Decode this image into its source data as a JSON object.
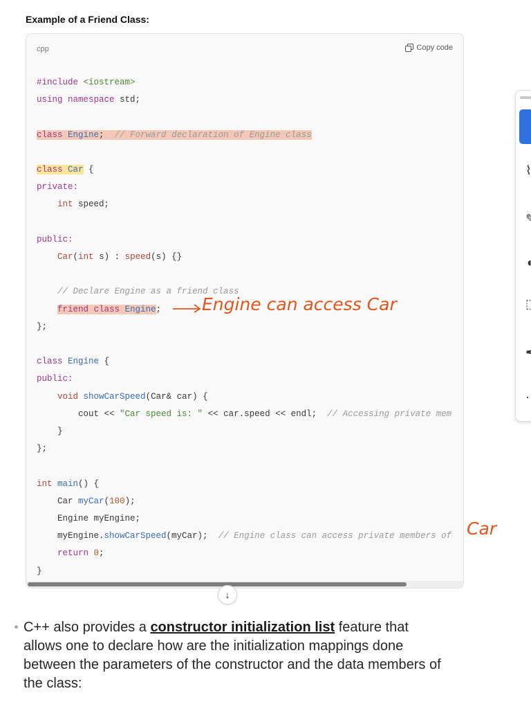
{
  "heading": "Example of a Friend Class:",
  "code_block": {
    "language": "cpp",
    "copy_label": "Copy code",
    "lines": {
      "l1_a": "#include ",
      "l1_b": "<iostream>",
      "l2_a": "using namespace",
      "l2_b": " std;",
      "l4_a": "class",
      "l4_b": " Engine",
      "l4_c": ";",
      "l4_d": "  // Forward declaration of Engine class",
      "l6_a": "class",
      "l6_b": " Car",
      "l6_c": " {",
      "l7": "private:",
      "l8_a": "int",
      "l8_b": " speed;",
      "l10": "public:",
      "l11_a": "Car",
      "l11_b": "(",
      "l11_c": "int",
      "l11_d": " s) : ",
      "l11_e": "speed",
      "l11_f": "(s) {}",
      "l13": "// Declare Engine as a friend class",
      "l14_a": "friend class",
      "l14_b": " Engine",
      "l14_c": ";",
      "l15": "};",
      "l17_a": "class",
      "l17_b": " Engine",
      "l17_c": " {",
      "l18": "public:",
      "l19_a": "void",
      "l19_b": " showCarSpeed",
      "l19_c": "(Car& car) {",
      "l20_a": "cout << ",
      "l20_b": "\"Car speed is: \"",
      "l20_c": " << car.speed << endl;",
      "l20_d": "  // Accessing private mem",
      "l21": "}",
      "l22": "};",
      "l24_a": "int",
      "l24_b": " main",
      "l24_c": "() {",
      "l25_a": "Car ",
      "l25_b": "myCar",
      "l25_c": "(",
      "l25_d": "100",
      "l25_e": ");",
      "l26": "Engine myEngine;",
      "l27_a": "myEngine.",
      "l27_b": "showCarSpeed",
      "l27_c": "(myCar);",
      "l27_d": "  // Engine class can access private members of",
      "l28_a": "return",
      "l28_b": " 0",
      "l28_c": ";",
      "l29": "}"
    }
  },
  "annotations": {
    "friend_note": "Engine can access Car",
    "end_note": "Car"
  },
  "scroll_button": "↓",
  "palette": {
    "tools": [
      "pen-tool",
      "pencil-tool",
      "eraser-tool",
      "selection-tool",
      "highlighter-tool",
      "more-tool"
    ]
  },
  "body_text": {
    "before": "C++ also provides a ",
    "link": "constructor initialization list",
    "after": " feature that allows one to declare how are the initialization mappings done between the parameters of the constructor and the data members of the class:"
  },
  "colors": {
    "keyword": "#a0368a",
    "type": "#b0453c",
    "function": "#3a6eb5",
    "string": "#4d8a33",
    "annotation": "#e2561e",
    "palette_active": "#2f72e0"
  }
}
